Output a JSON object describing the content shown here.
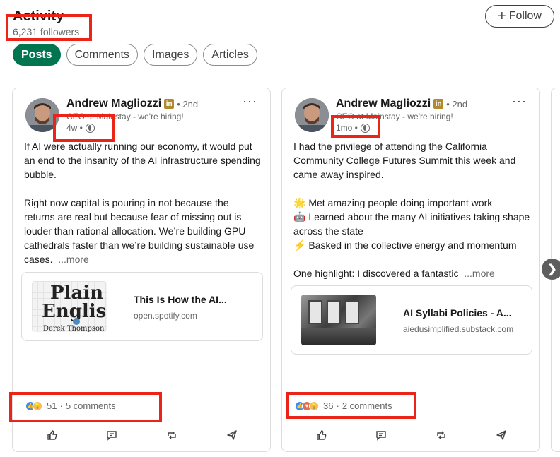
{
  "header": {
    "title": "Activity",
    "followers": "6,231 followers",
    "follow_label": "Follow"
  },
  "tabs": [
    {
      "label": "Posts",
      "active": true
    },
    {
      "label": "Comments"
    },
    {
      "label": "Images"
    },
    {
      "label": "Articles"
    }
  ],
  "posts": [
    {
      "author": "Andrew Magliozzi",
      "badge": "in",
      "degree": "• 2nd",
      "headline": "CEO at Mainstay - we're hiring!",
      "time": "4w •",
      "body": [
        "If AI were actually running our economy, it would put an end to the insanity of the AI infrastructure spending bubble.",
        "Right now capital is pouring in not because the returns are real but because fear of missing out is louder than rational allocation. We’re building GPU cathedrals faster than we’re building sustainable use cases."
      ],
      "more": "...more",
      "link": {
        "title": "This Is How the AI...",
        "source": "open.spotify.com",
        "thumb_line1": "Plain",
        "thumb_line2": "English",
        "thumb_line3": "Derek Thompson"
      },
      "reaction_count": "51",
      "comments": "5 comments"
    },
    {
      "author": "Andrew Magliozzi",
      "badge": "in",
      "degree": "• 2nd",
      "headline": "CEO at Mainstay - we're hiring!",
      "time": "1mo •",
      "body": [
        "I had the privilege of attending the California Community College Futures Summit this week and came away inspired.",
        "🌟 Met amazing people doing important work\n🤖 Learned about the many AI initiatives taking shape across the state\n⚡ Basked in the collective energy and momentum",
        "One highlight: I discovered a fantastic"
      ],
      "more": "...more",
      "link": {
        "title": "AI Syllabi Policies - A...",
        "source": "aiedusimplified.substack.com"
      },
      "reaction_count": "36",
      "comments": "2 comments"
    }
  ],
  "icons": {
    "menu": "more-icon",
    "like": "like-icon",
    "comment": "comment-icon",
    "repost": "repost-icon",
    "send": "send-icon",
    "next": "chevron-right-icon"
  },
  "colors": {
    "accent_green": "#01754f",
    "highlight_red": "#ec2418",
    "like_blue": "#378fe9"
  }
}
